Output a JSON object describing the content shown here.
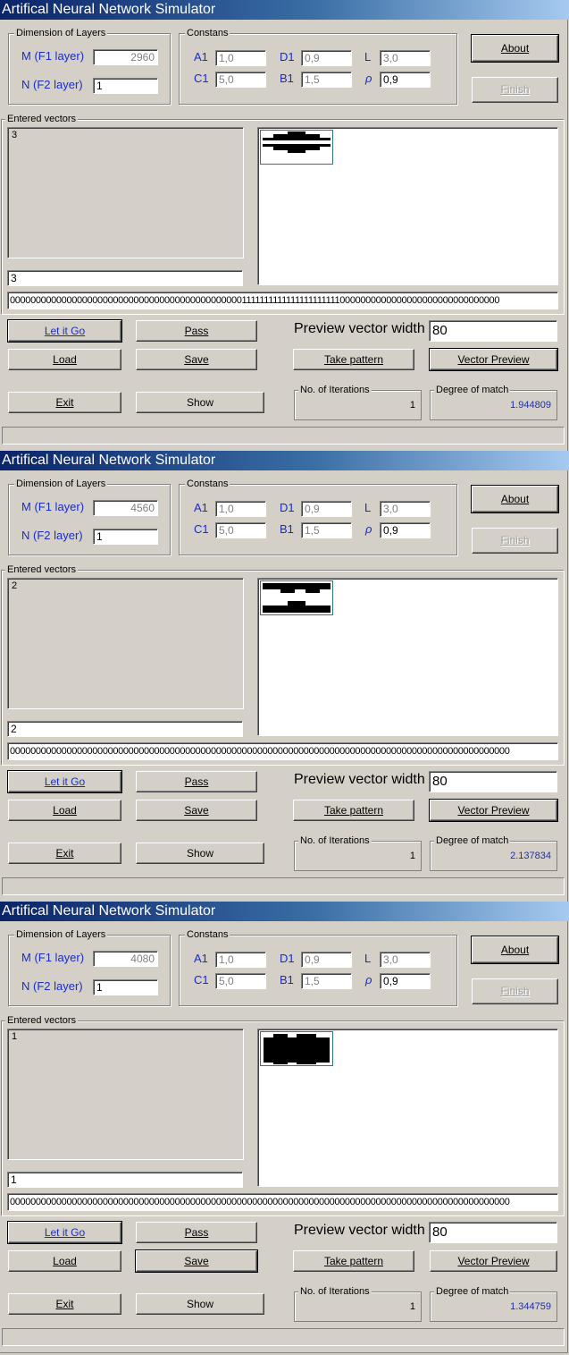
{
  "app": {
    "title": "Artifical Neural Network Simulator"
  },
  "labels": {
    "dimension_group": "Dimension of Layers",
    "m_label": "M (F1 layer)",
    "n_label": "N (F2 layer)",
    "constants_group": "Constans",
    "a1": "A1",
    "c1": "C1",
    "d1": "D1",
    "b1": "B1",
    "l": "L",
    "rho": "ρ",
    "entered_vectors": "Entered vectors",
    "preview_width": "Preview vector width",
    "iterations": "No. of Iterations",
    "degree": "Degree of match"
  },
  "buttons": {
    "about": "About",
    "finish": "Finish",
    "let_it_go": "Let it Go",
    "pass": "Pass",
    "load": "Load",
    "save": "Save",
    "take_pattern": "Take pattern",
    "vector_preview": "Vector Preview",
    "exit": "Exit",
    "show": "Show"
  },
  "windows": [
    {
      "m_value": "2960",
      "n_value": "1",
      "a1": "1,0",
      "c1": "5,0",
      "d1": "0,9",
      "b1": "1,5",
      "l": "3,0",
      "rho": "0,9",
      "list_item": "3",
      "current_input": "3",
      "vector": "00000000000000000000000000000000000000000000011111111111111111111110000000000000000000000000000000",
      "preview_width": "80",
      "iterations": "1",
      "degree": "1.944809",
      "pattern": "bars"
    },
    {
      "m_value": "4560",
      "n_value": "1",
      "a1": "1,0",
      "c1": "5,0",
      "d1": "0,9",
      "b1": "1,5",
      "l": "3,0",
      "rho": "0,9",
      "list_item": "2",
      "current_input": "2",
      "vector": "0000000000000000000000000000000000000000000000000000000000000000000000000000000000000000000000000",
      "preview_width": "80",
      "iterations": "1",
      "degree": "2.137834",
      "pattern": "hourglass"
    },
    {
      "m_value": "4080",
      "n_value": "1",
      "a1": "1,0",
      "c1": "5,0",
      "d1": "0,9",
      "b1": "1,5",
      "l": "3,0",
      "rho": "0,9",
      "list_item": "1",
      "current_input": "1",
      "vector": "0000000000000000000000000000000000000000000000000000000000000000000000000000000000000000000000000",
      "preview_width": "80",
      "iterations": "1",
      "degree": "1.344759",
      "pattern": "block"
    }
  ]
}
